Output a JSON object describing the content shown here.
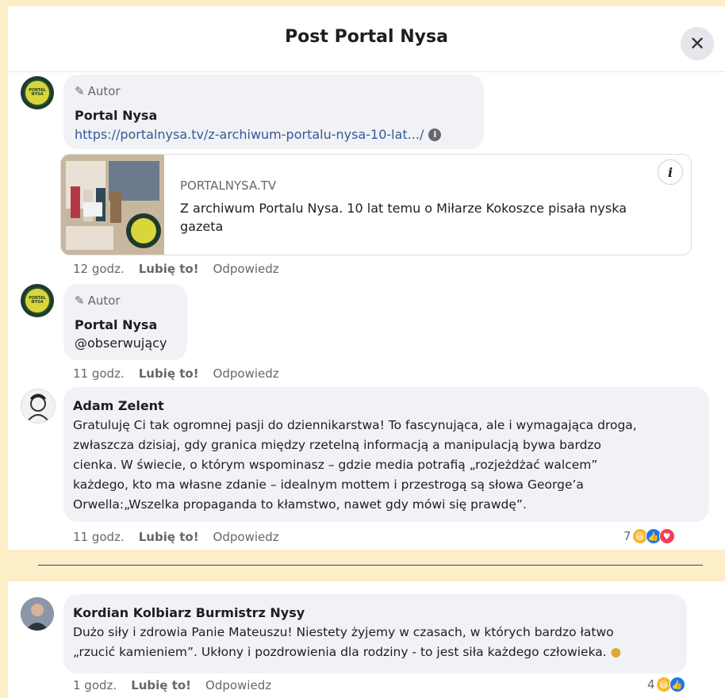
{
  "header": {
    "title": "Post Portal Nysa",
    "close_glyph": "✕"
  },
  "comments": [
    {
      "badge": "Autor",
      "name": "Portal Nysa",
      "link": "https://portalnysa.tv/z-archiwum-portalu-nysa-10-lat.../",
      "preview": {
        "domain": "PORTALNYSA.TV",
        "title": "Z archiwum Portalu Nysa. 10 lat temu o Miłarze Kokoszce pisała nyska gazeta"
      },
      "time": "12 godz.",
      "like": "Lubię to!",
      "reply": "Odpowiedz"
    },
    {
      "badge": "Autor",
      "name": "Portal Nysa",
      "text": "@obserwujący",
      "time": "11 godz.",
      "like": "Lubię to!",
      "reply": "Odpowiedz"
    },
    {
      "name": "Adam Zelent",
      "text_lines": [
        "Gratuluję Ci tak ogromnej pasji do dziennikarstwa! To fascynująca, ale i wymagająca droga,",
        "zwłaszcza dzisiaj, gdy granica między rzetelną informacją a manipulacją bywa bardzo",
        "cienka. W świecie, o którym wspominasz – gdzie media potrafią „rozjeżdżać walcem”",
        "każdego, kto ma własne zdanie – idealnym mottem i przestrogą są słowa George’a",
        "Orwella:„Wszelka propaganda to kłamstwo, nawet gdy mówi się prawdę”."
      ],
      "time": "11 godz.",
      "like": "Lubię to!",
      "reply": "Odpowiedz",
      "reaction_count": "7"
    },
    {
      "name": "Kordian Kolbiarz Burmistrz Nysy",
      "text_lines": [
        "Dużo siły i zdrowia Panie Mateuszu! Niestety żyjemy w czasach, w których bardzo łatwo",
        "„rzucić kamieniem”. Ukłony i pozdrowienia dla rodziny - to jest siła każdego człowieka."
      ],
      "time": "1 godz.",
      "like": "Lubię to!",
      "reply": "Odpowiedz",
      "reaction_count": "4"
    }
  ],
  "colors": {
    "background": "#fcefc7",
    "link": "#385898",
    "bubble": "#f0f2f5",
    "like_blue": "#1877f2",
    "haha_yellow": "#f7b928",
    "love_red": "#f33e58"
  },
  "icons": [
    "pencil-icon",
    "info-icon",
    "close-icon",
    "like-reaction-icon",
    "haha-reaction-icon",
    "love-reaction-icon",
    "emoji-icon"
  ]
}
